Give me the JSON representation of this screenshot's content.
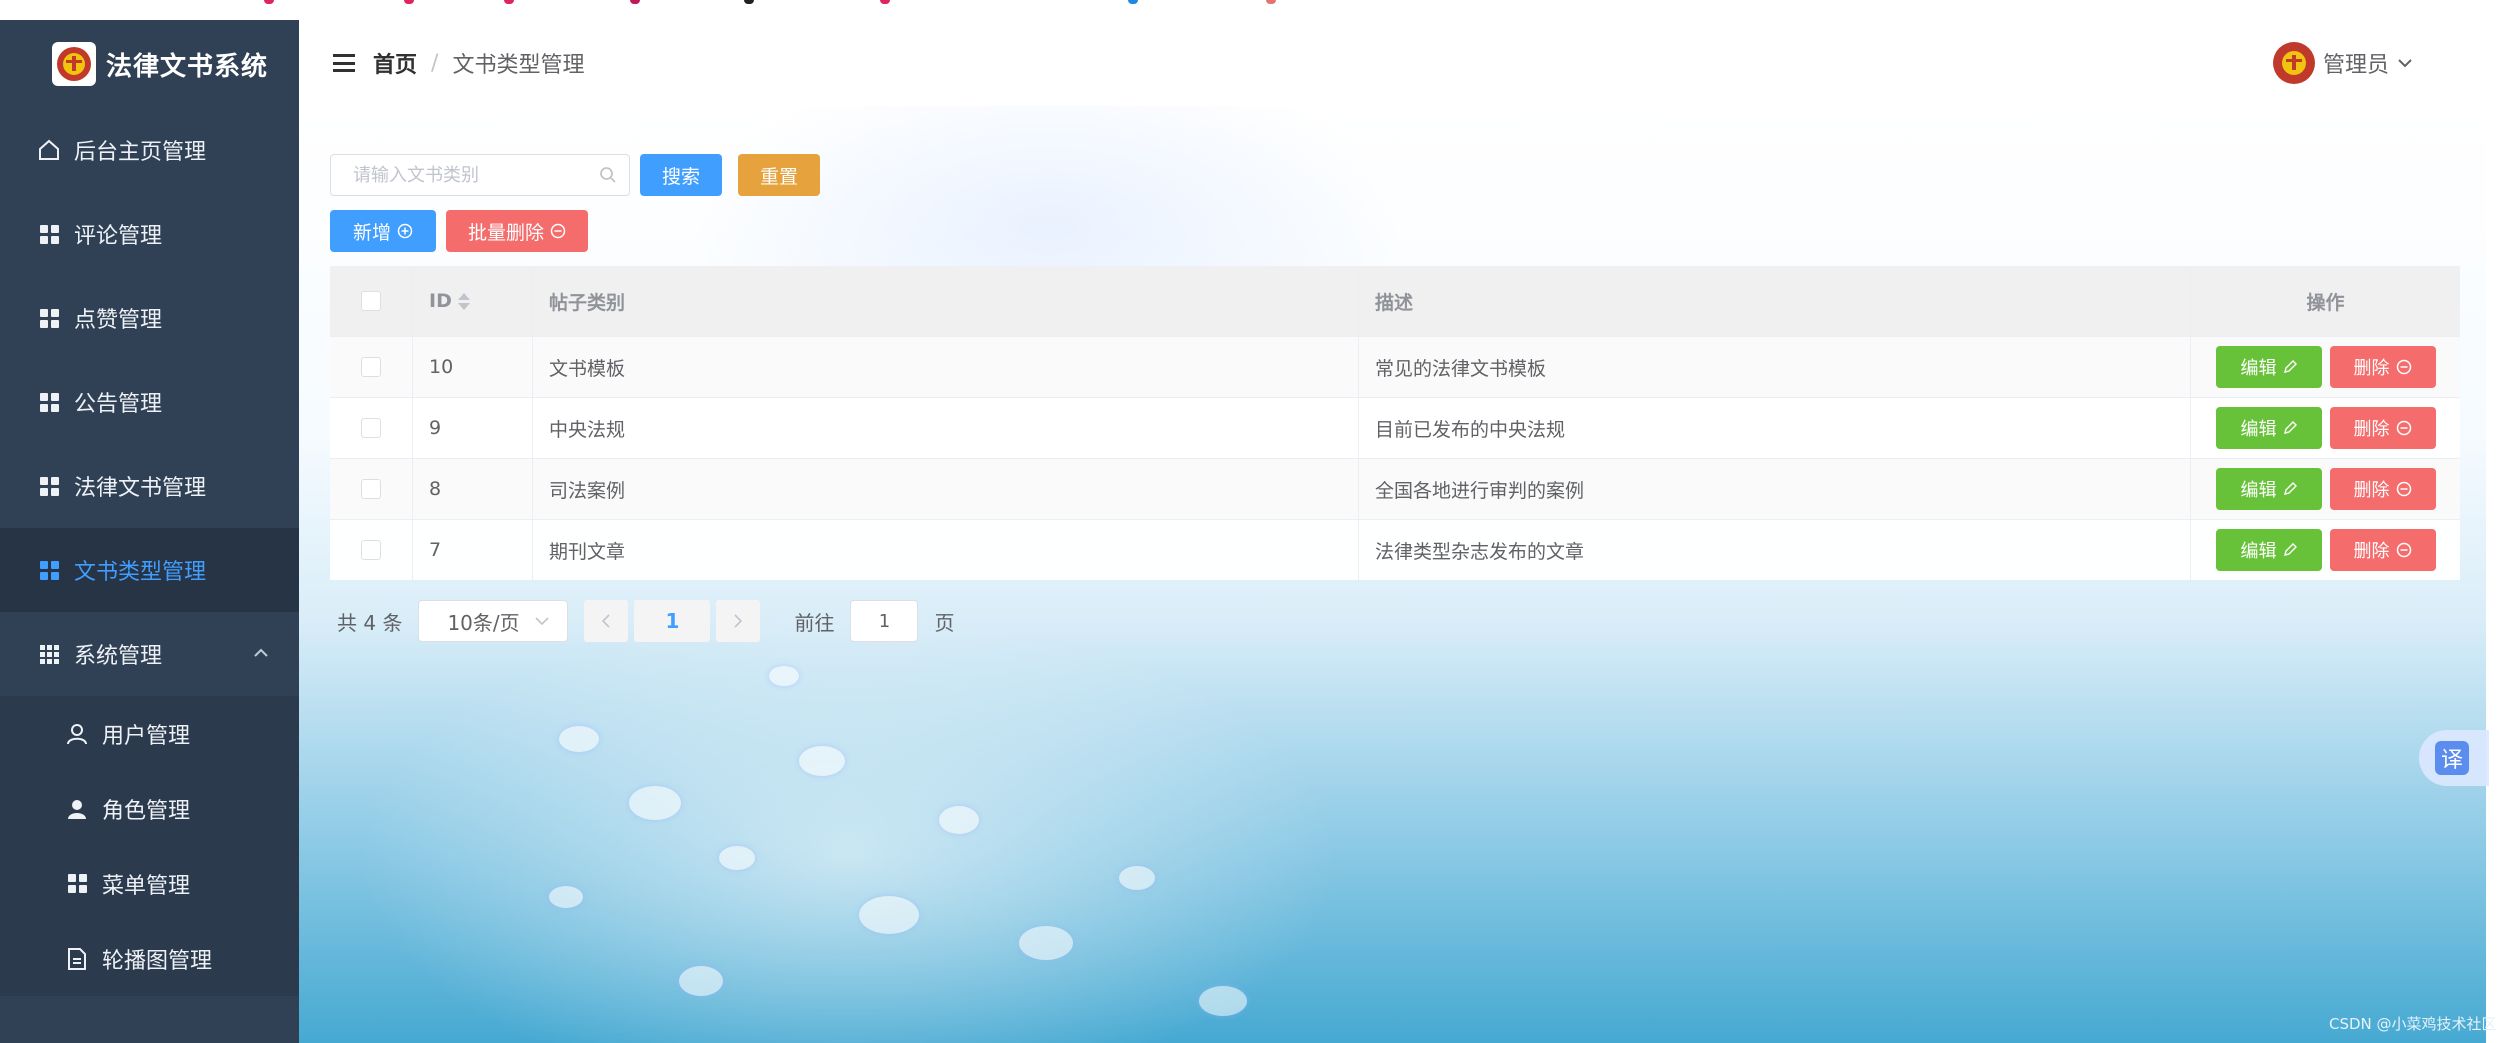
{
  "app": {
    "title": "法律文书系统"
  },
  "colors": {
    "sidebar_bg": "#304156",
    "accent": "#409eff",
    "success": "#67c23a",
    "warning": "#e6a23c",
    "danger": "#f56c6c"
  },
  "sidebar": {
    "items": [
      {
        "label": "后台主页管理",
        "icon": "home-icon"
      },
      {
        "label": "评论管理",
        "icon": "grid-icon"
      },
      {
        "label": "点赞管理",
        "icon": "grid-icon"
      },
      {
        "label": "公告管理",
        "icon": "grid-icon"
      },
      {
        "label": "法律文书管理",
        "icon": "grid-icon"
      },
      {
        "label": "文书类型管理",
        "icon": "grid-icon",
        "active": true
      },
      {
        "label": "系统管理",
        "icon": "apps-icon",
        "expanded": true
      }
    ],
    "sub_items": [
      {
        "label": "用户管理",
        "icon": "user-outline-icon"
      },
      {
        "label": "角色管理",
        "icon": "user-solid-icon"
      },
      {
        "label": "菜单管理",
        "icon": "grid-icon"
      },
      {
        "label": "轮播图管理",
        "icon": "document-icon"
      }
    ]
  },
  "header": {
    "breadcrumb": {
      "home": "首页",
      "separator": "/",
      "current": "文书类型管理"
    },
    "user": {
      "name": "管理员"
    }
  },
  "toolbar": {
    "search_placeholder": "请输入文书类别",
    "search_label": "搜索",
    "reset_label": "重置",
    "add_label": "新增",
    "batch_delete_label": "批量删除"
  },
  "table": {
    "columns": {
      "id": "ID",
      "type": "帖子类别",
      "desc": "描述",
      "ops": "操作"
    },
    "rows": [
      {
        "id": "10",
        "type": "文书模板",
        "desc": "常见的法律文书模板"
      },
      {
        "id": "9",
        "type": "中央法规",
        "desc": "目前已发布的中央法规"
      },
      {
        "id": "8",
        "type": "司法案例",
        "desc": "全国各地进行审判的案例"
      },
      {
        "id": "7",
        "type": "期刊文章",
        "desc": "法律类型杂志发布的文章"
      }
    ],
    "edit_label": "编辑",
    "delete_label": "删除"
  },
  "pagination": {
    "total": "共 4 条",
    "page_size": "10条/页",
    "current_page": "1",
    "goto_prefix": "前往",
    "goto_value": "1",
    "goto_suffix": "页"
  },
  "translate": {
    "label": "译"
  },
  "watermark": {
    "text": "CSDN @小菜鸡技术社区"
  }
}
